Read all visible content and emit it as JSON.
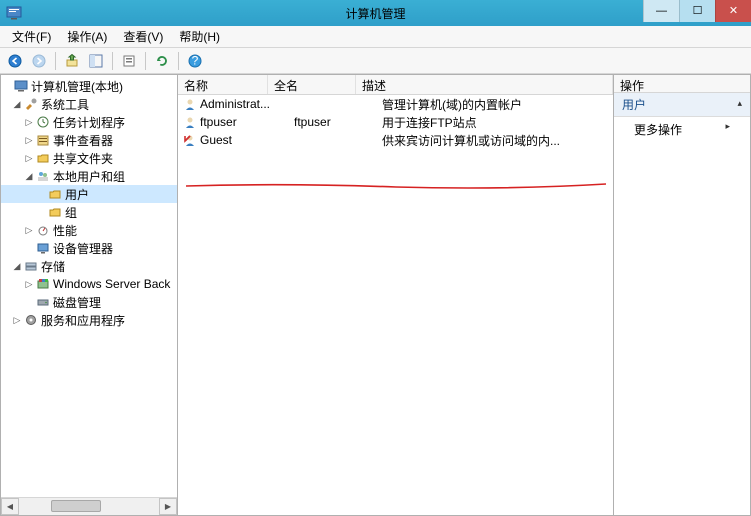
{
  "window": {
    "title": "计算机管理"
  },
  "menu": {
    "file": "文件(F)",
    "action": "操作(A)",
    "view": "查看(V)",
    "help": "帮助(H)"
  },
  "tree": {
    "root": "计算机管理(本地)",
    "sys_tools": "系统工具",
    "task_scheduler": "任务计划程序",
    "event_viewer": "事件查看器",
    "shared_folders": "共享文件夹",
    "local_users_groups": "本地用户和组",
    "users": "用户",
    "groups": "组",
    "performance": "性能",
    "device_manager": "设备管理器",
    "storage": "存储",
    "wsb": "Windows Server Back",
    "disk_mgmt": "磁盘管理",
    "services_apps": "服务和应用程序"
  },
  "list": {
    "cols": {
      "name": "名称",
      "fullname": "全名",
      "desc": "描述"
    },
    "rows": [
      {
        "name": "Administrat...",
        "full": "",
        "desc": "管理计算机(域)的内置帐户"
      },
      {
        "name": "ftpuser",
        "full": "ftpuser",
        "desc": "用于连接FTP站点"
      },
      {
        "name": "Guest",
        "full": "",
        "desc": "供来宾访问计算机或访问域的内..."
      }
    ]
  },
  "actions": {
    "header": "操作",
    "section": "用户",
    "more": "更多操作"
  }
}
